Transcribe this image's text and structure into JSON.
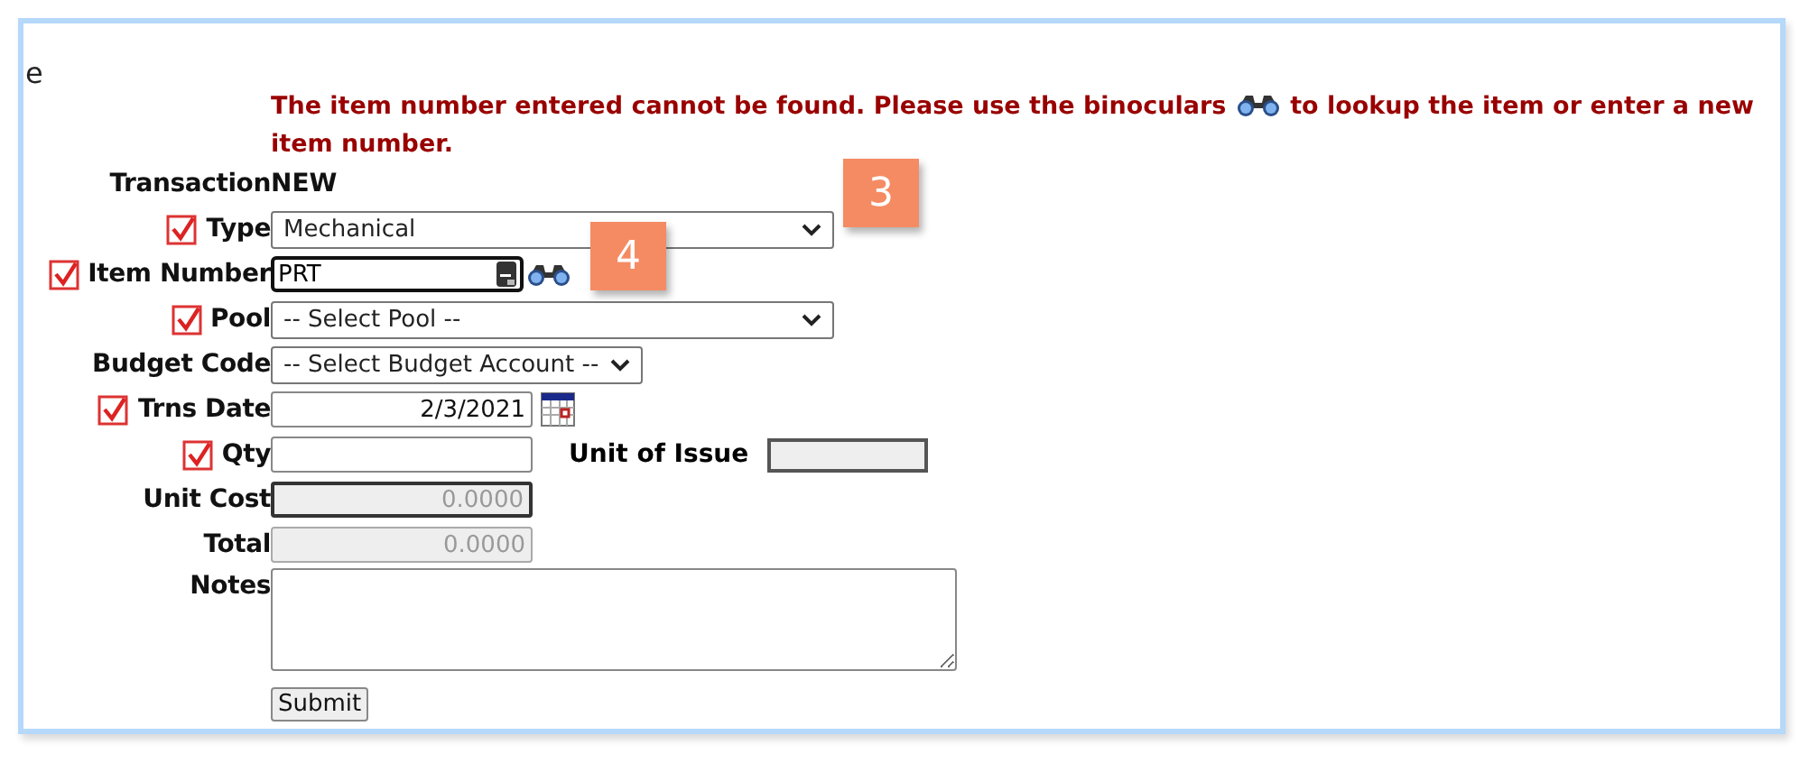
{
  "heading_fragment": "e",
  "error": {
    "text_before_icon": "The item number entered cannot be found. Please use the binoculars",
    "text_after_icon": "to lookup the item or enter a new item number."
  },
  "fields": [
    {
      "kind": "static",
      "label": "Transaction",
      "value": "NEW",
      "required": false
    },
    {
      "kind": "select",
      "label": "Type",
      "value": "Mechanical",
      "required": true
    },
    {
      "kind": "lookup",
      "label": "Item Number",
      "value": "PRT",
      "required": true,
      "focused": true
    },
    {
      "kind": "select",
      "label": "Pool",
      "value": "-- Select Pool --",
      "required": true
    },
    {
      "kind": "select-auto",
      "label": "Budget Code",
      "value": "-- Select Budget Account --",
      "required": false
    },
    {
      "kind": "date",
      "label": "Trns Date",
      "value": "2/3/2021",
      "required": true
    },
    {
      "kind": "input",
      "label": "Qty",
      "required": true,
      "extra": {
        "label": "Unit of Issue"
      }
    },
    {
      "kind": "readonly",
      "label": "Unit Cost",
      "value": "0.0000",
      "required": false,
      "focused": true
    },
    {
      "kind": "readonly",
      "label": "Total",
      "value": "0.0000",
      "required": false,
      "focused": false
    },
    {
      "kind": "textarea",
      "label": "Notes",
      "required": false
    }
  ],
  "submit": "Submit",
  "annotations": [
    {
      "label": "3"
    },
    {
      "label": "4"
    }
  ]
}
